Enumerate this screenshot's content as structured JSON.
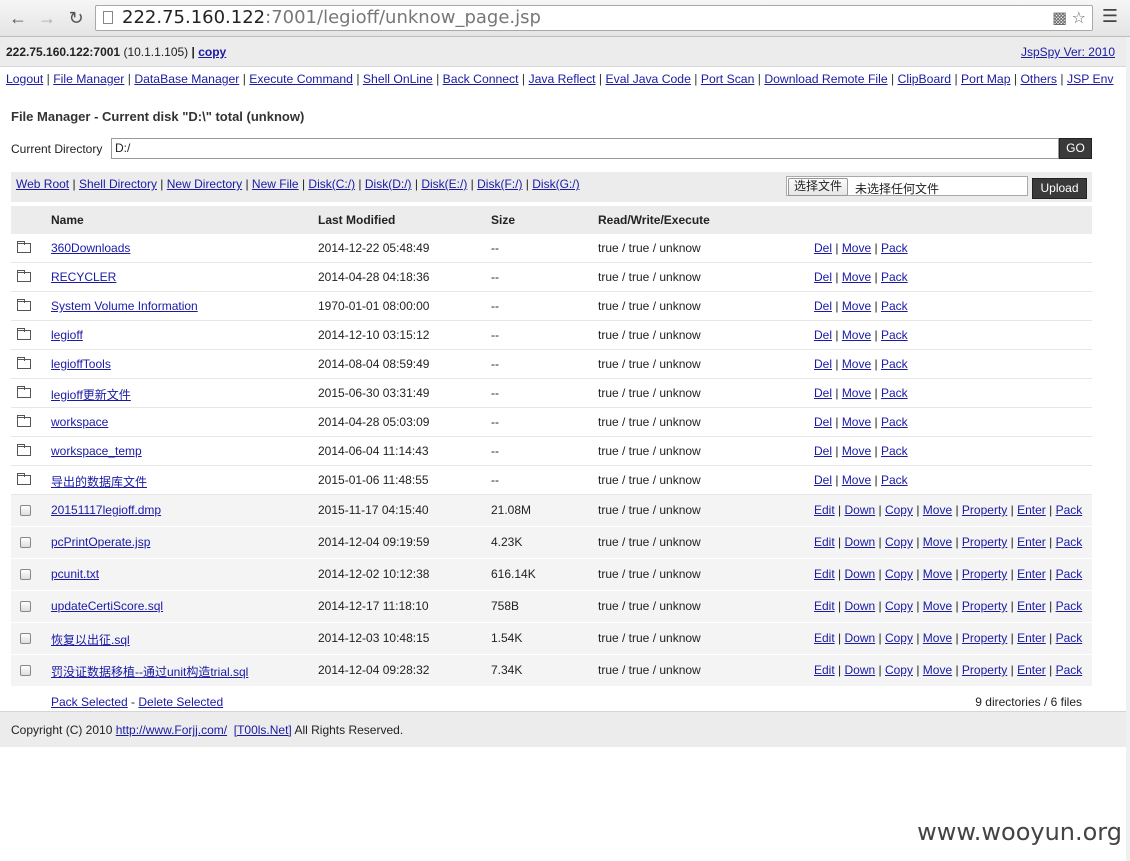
{
  "browser": {
    "url_host": "222.75.160.122",
    "url_rest": ":7001/legioff/unknow_page.jsp",
    "back_icon": "back-arrow-icon",
    "forward_icon": "forward-arrow-icon",
    "reload_icon": "reload-icon"
  },
  "infobar": {
    "server": "222.75.160.122:7001",
    "local_ip": "(10.1.1.105)",
    "sep": "|",
    "copy": "copy",
    "version": "JspSpy Ver: 2010"
  },
  "nav": [
    "Logout",
    "File Manager",
    "DataBase Manager",
    "Execute Command",
    "Shell OnLine",
    "Back Connect",
    "Java Reflect",
    "Eval Java Code",
    "Port Scan",
    "Download Remote File",
    "ClipBoard",
    "Port Map",
    "Others",
    "JSP Env"
  ],
  "title": "File Manager - Current disk \"D:\\\" total (unknow)",
  "current_directory": {
    "label": "Current Directory",
    "value": "D:/",
    "go": "GO"
  },
  "toolbar": {
    "links": [
      "Web Root",
      "Shell Directory",
      "New Directory",
      "New File",
      "Disk(C:/)",
      "Disk(D:/)",
      "Disk(E:/)",
      "Disk(F:/)",
      "Disk(G:/)"
    ],
    "choose_file": "选择文件",
    "no_file": "未选择任何文件",
    "upload": "Upload"
  },
  "table": {
    "headers": {
      "name": "Name",
      "modified": "Last Modified",
      "size": "Size",
      "rwe": "Read/Write/Execute"
    },
    "dir_actions": [
      "Del",
      "Move",
      "Pack"
    ],
    "file_actions": [
      "Edit",
      "Down",
      "Copy",
      "Move",
      "Property",
      "Enter",
      "Pack"
    ],
    "dirs": [
      {
        "name": "360Downloads",
        "modified": "2014-12-22 05:48:49",
        "size": "--",
        "rwe": "true / true / unknow"
      },
      {
        "name": "RECYCLER",
        "modified": "2014-04-28 04:18:36",
        "size": "--",
        "rwe": "true / true / unknow"
      },
      {
        "name": "System Volume Information",
        "modified": "1970-01-01 08:00:00",
        "size": "--",
        "rwe": "true / true / unknow"
      },
      {
        "name": "legioff",
        "modified": "2014-12-10 03:15:12",
        "size": "--",
        "rwe": "true / true / unknow"
      },
      {
        "name": "legioffTools",
        "modified": "2014-08-04 08:59:49",
        "size": "--",
        "rwe": "true / true / unknow"
      },
      {
        "name": "legioff更新文件",
        "modified": "2015-06-30 03:31:49",
        "size": "--",
        "rwe": "true / true / unknow"
      },
      {
        "name": "workspace",
        "modified": "2014-04-28 05:03:09",
        "size": "--",
        "rwe": "true / true / unknow"
      },
      {
        "name": "workspace_temp",
        "modified": "2014-06-04 11:14:43",
        "size": "--",
        "rwe": "true / true / unknow"
      },
      {
        "name": "导出的数据库文件",
        "modified": "2015-01-06 11:48:55",
        "size": "--",
        "rwe": "true / true / unknow"
      }
    ],
    "files": [
      {
        "name": "20151117legioff.dmp",
        "modified": "2015-11-17 04:15:40",
        "size": "21.08M",
        "rwe": "true / true / unknow"
      },
      {
        "name": "pcPrintOperate.jsp",
        "modified": "2014-12-04 09:19:59",
        "size": "4.23K",
        "rwe": "true / true / unknow"
      },
      {
        "name": "pcunit.txt",
        "modified": "2014-12-02 10:12:38",
        "size": "616.14K",
        "rwe": "true / true / unknow"
      },
      {
        "name": "updateCertiScore.sql",
        "modified": "2014-12-17 11:18:10",
        "size": "758B",
        "rwe": "true / true / unknow"
      },
      {
        "name": "恢复以出征.sql",
        "modified": "2014-12-03 10:48:15",
        "size": "1.54K",
        "rwe": "true / true / unknow"
      },
      {
        "name": "罚没证数据移植--通过unit构造trial.sql",
        "modified": "2014-12-04 09:28:32",
        "size": "7.34K",
        "rwe": "true / true / unknow"
      }
    ],
    "footer": {
      "pack_selected": "Pack Selected",
      "dash": " - ",
      "delete_selected": "Delete Selected",
      "summary": "9 directories / 6 files"
    }
  },
  "footer": {
    "prefix": "Copyright (C) 2010 ",
    "link1": "http://www.Forjj.com/",
    "link2": "[T00ls.Net]",
    "suffix": " All Rights Reserved."
  },
  "watermark": "www.wooyun.org"
}
